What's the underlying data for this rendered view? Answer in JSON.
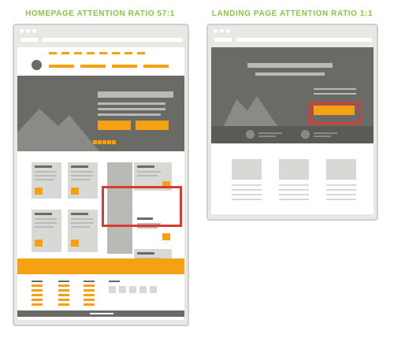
{
  "titles": {
    "homepage": "HOMEPAGE ATTENTION RATIO 57:1",
    "landing": "LANDING PAGE ATTENTION RATIO 1:1"
  },
  "colors": {
    "title": "#8bc34a",
    "accent": "#f5a113",
    "highlight": "#d93a32",
    "hero": "#6a6a67",
    "frame": "#e8e8e5"
  },
  "icons": [
    "browser-dot-icon",
    "avatar-circle-icon",
    "mountain-illustration"
  ]
}
